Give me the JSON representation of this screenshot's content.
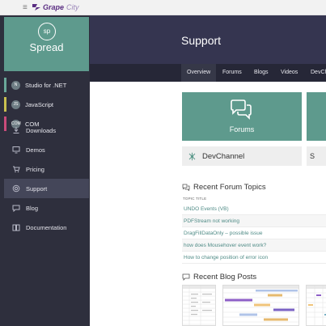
{
  "app": {
    "brand_logo_text": "GrapeCity",
    "product_badge": "sp",
    "product_name": "Spread"
  },
  "sidebar": {
    "products": [
      {
        "badge": "N",
        "label": "Studio for .NET",
        "accent": "#6aa89a"
      },
      {
        "badge": "JS",
        "label": "JavaScript",
        "accent": "#c9c04f"
      },
      {
        "badge": "COM",
        "label": "COM",
        "accent": "#c94b7a"
      }
    ],
    "nav": [
      {
        "label": "Downloads",
        "icon": "download-icon",
        "active": false
      },
      {
        "label": "Demos",
        "icon": "monitor-icon",
        "active": false
      },
      {
        "label": "Pricing",
        "icon": "cart-icon",
        "active": false
      },
      {
        "label": "Support",
        "icon": "lifebuoy-icon",
        "active": true
      },
      {
        "label": "Blog",
        "icon": "chat-bubble-icon",
        "active": false
      },
      {
        "label": "Documentation",
        "icon": "book-icon",
        "active": false
      }
    ]
  },
  "header": {
    "title": "Support",
    "tabs": [
      "Overview",
      "Forums",
      "Blogs",
      "Videos",
      "DevCh"
    ],
    "active_tab": "Overview"
  },
  "tiles": {
    "forums": "Forums",
    "devchannel": "DevChannel",
    "second_partial": "S"
  },
  "forum": {
    "section_title": "Recent Forum Topics",
    "column_header": "TOPIC TITLE",
    "topics": [
      "UNDO Events (VB)",
      "PDFStream not working",
      "DragFillDataOnly – possible issue",
      "how does Mousehover event work?",
      "How to change position of error icon"
    ]
  },
  "blog": {
    "section_title": "Recent Blog Posts"
  },
  "colors": {
    "accent_teal": "#5e9a8d",
    "sidebar_bg": "#2e2f3d",
    "header_bg": "#353550",
    "link": "#4f8b86"
  }
}
